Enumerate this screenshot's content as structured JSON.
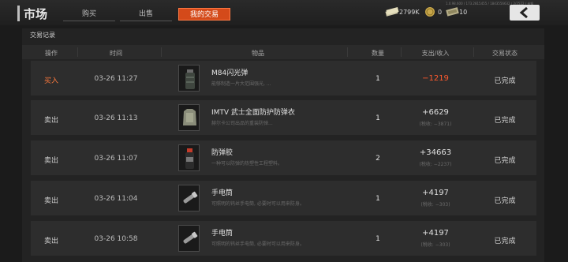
{
  "header": {
    "title": "市场",
    "tabs": [
      {
        "label": "购买",
        "active": false
      },
      {
        "label": "出售",
        "active": false
      },
      {
        "label": "我的交易",
        "active": true
      }
    ],
    "currencies": [
      {
        "icon": "cash-stack-icon",
        "value": "2799K"
      },
      {
        "icon": "coin-icon",
        "value": "0"
      },
      {
        "icon": "ticket-icon",
        "value": "10"
      }
    ],
    "version_text": "1.0.98.600 / 173.2815455 / 1843556632 / 2/2522 / 未知",
    "back_icon": "back-arrow-icon"
  },
  "colors": {
    "accent": "#d44a1a",
    "buy": "#ff7a3d",
    "negative": "#ff5a2e"
  },
  "section_title": "交易记录",
  "columns": [
    "操作",
    "时间",
    "物品",
    "数量",
    "支出/收入",
    "交易状态"
  ],
  "rows": [
    {
      "op": "买入",
      "op_type": "buy",
      "time": "03-26 11:27",
      "item": "M84闪光弹",
      "desc": "能够制造一片大范围强光, ...",
      "icon": "flashbang-icon",
      "qty": "1",
      "amount": "−1219",
      "tax": "",
      "status": "已完成"
    },
    {
      "op": "卖出",
      "op_type": "sell",
      "time": "03-26 11:13",
      "item": "IMTV 武士全面防护防弹衣",
      "desc": "赫尔卡公司出品的重装防弹...",
      "icon": "body-armor-icon",
      "qty": "1",
      "amount": "+6629",
      "tax": "(税收: −3871)",
      "status": "已完成"
    },
    {
      "op": "卖出",
      "op_type": "sell",
      "time": "03-26 11:07",
      "item": "防弹胶",
      "desc": "一种可以防弹的热塑性工程塑料。",
      "icon": "bulletproof-glue-icon",
      "qty": "2",
      "amount": "+34663",
      "tax": "(税收: −2237)",
      "status": "已完成"
    },
    {
      "op": "卖出",
      "op_type": "sell",
      "time": "03-26 11:04",
      "item": "手电筒",
      "desc": "可照明的钨丝手电筒, 必要时可以用来防身。",
      "icon": "flashlight-icon",
      "qty": "1",
      "amount": "+4197",
      "tax": "(税收: −303)",
      "status": "已完成"
    },
    {
      "op": "卖出",
      "op_type": "sell",
      "time": "03-26 10:58",
      "item": "手电筒",
      "desc": "可照明的钨丝手电筒, 必要时可以用来防身。",
      "icon": "flashlight-icon",
      "qty": "1",
      "amount": "+4197",
      "tax": "(税收: −303)",
      "status": "已完成"
    }
  ]
}
